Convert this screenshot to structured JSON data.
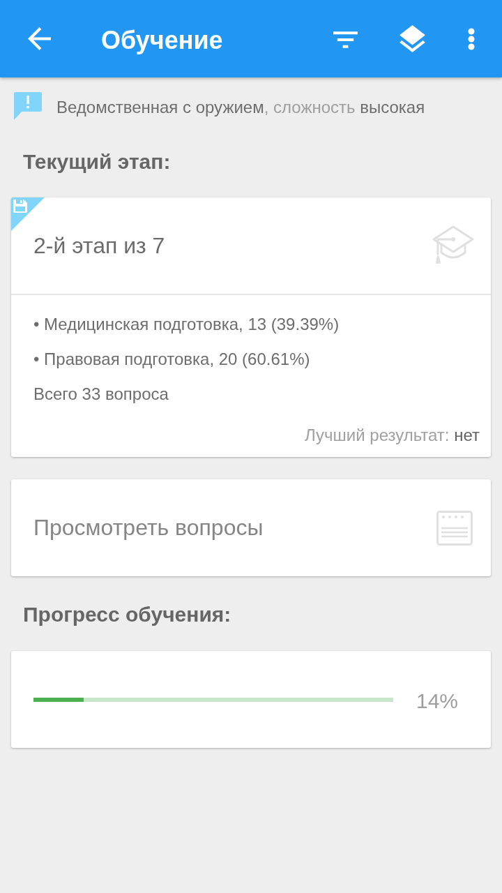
{
  "app_bar": {
    "title": "Обучение"
  },
  "info": {
    "text": "**Ведомственная с оружием**, сложность **высокая**"
  },
  "current_stage": {
    "heading": "Текущий этап:",
    "saved": true,
    "title": "2-й этап из 7",
    "topics": [
      "• Медицинская подготовка, 13 (39.39%)",
      "• Правовая подготовка, 20 (60.61%)"
    ],
    "total": "Всего 33 вопроса",
    "best_result": "Лучший результат: **нет**"
  },
  "questions_card": {
    "label": "Просмотреть вопросы"
  },
  "progress": {
    "heading": "Прогресс обучения:",
    "level": 0.14,
    "reading": "14%"
  }
}
